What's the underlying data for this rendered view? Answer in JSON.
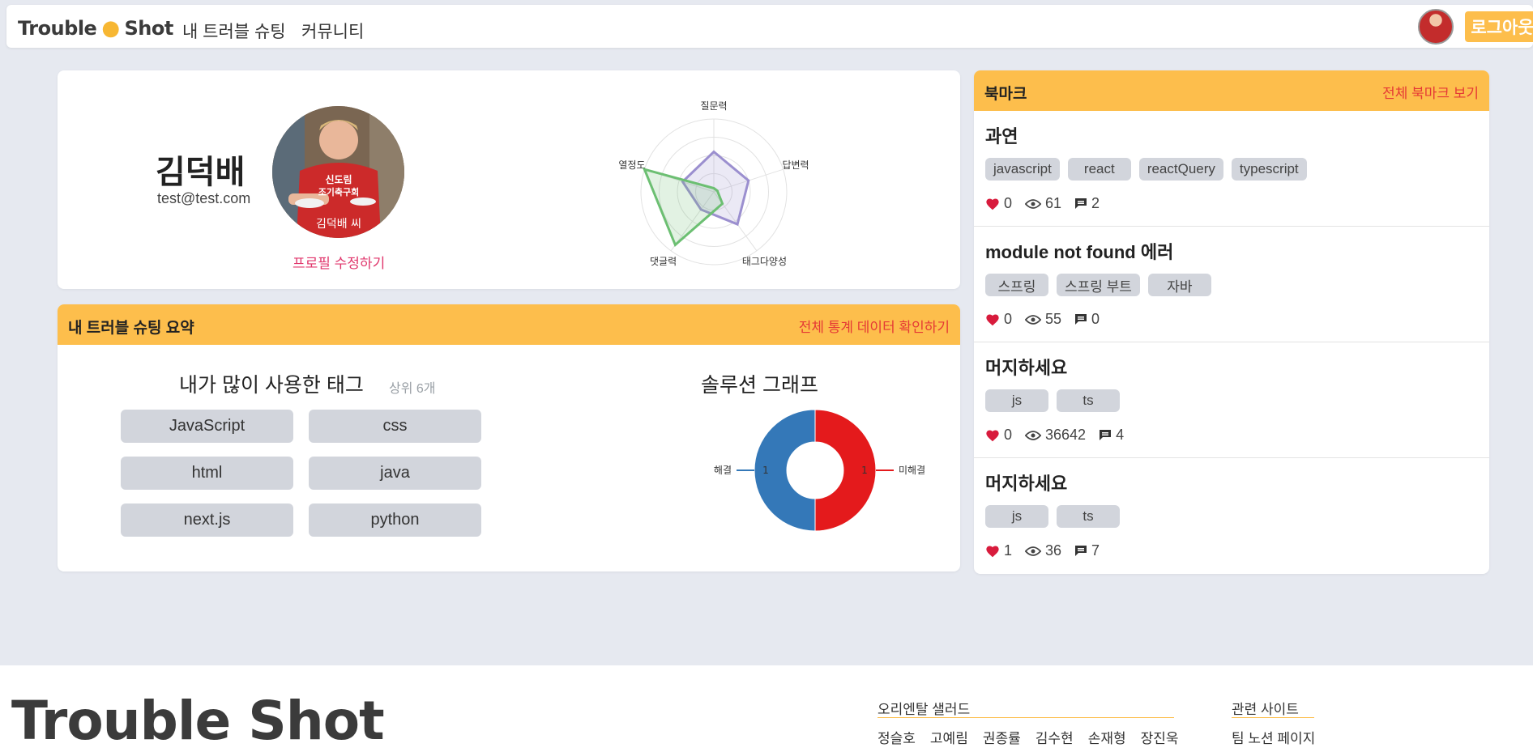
{
  "nav": {
    "logo_left": "Trouble",
    "logo_right": "Shot",
    "links": [
      "내 트러블 슈팅",
      "커뮤니티"
    ],
    "logout_label": "로그아웃"
  },
  "profile": {
    "name": "김덕배",
    "email": "test@test.com",
    "photo_caption": "김덕배 씨",
    "shirt_text_1": "신도림",
    "shirt_text_2": "조기축구회",
    "edit_label": "프로필 수정하기",
    "radar": {
      "axes": [
        "질문력",
        "답변력",
        "태그다양성",
        "댓글력",
        "열정도"
      ],
      "series": [
        {
          "color": "#9b8fcf",
          "values": [
            0.55,
            0.5,
            0.55,
            0.3,
            0.45
          ]
        },
        {
          "color": "#6cbf72",
          "values": [
            0.05,
            0.05,
            0.2,
            0.9,
            1.0
          ]
        }
      ]
    }
  },
  "summary": {
    "header_title": "내 트러블 슈팅 요약",
    "header_link": "전체 통계 데이터 확인하기",
    "tags_title": "내가 많이 사용한 태그",
    "tags_sub": "상위 6개",
    "tags": [
      "JavaScript",
      "css",
      "html",
      "java",
      "next.js",
      "python"
    ],
    "graph_title": "솔루션 그래프"
  },
  "chart_data": {
    "type": "pie",
    "categories": [
      "해결",
      "미해결"
    ],
    "values": [
      1,
      1
    ],
    "colors": [
      "#3478b8",
      "#e41a1c"
    ]
  },
  "bookmarks": {
    "header_title": "북마크",
    "header_link": "전체 북마크 보기",
    "items": [
      {
        "title": "과연",
        "tags": [
          "javascript",
          "react",
          "reactQuery",
          "typescript"
        ],
        "likes": "0",
        "views": "61",
        "comments": "2"
      },
      {
        "title": "module not found 에러",
        "tags": [
          "스프링",
          "스프링 부트",
          "자바"
        ],
        "likes": "0",
        "views": "55",
        "comments": "0"
      },
      {
        "title": "머지하세요",
        "tags": [
          "js",
          "ts"
        ],
        "likes": "0",
        "views": "36642",
        "comments": "4"
      },
      {
        "title": "머지하세요",
        "tags": [
          "js",
          "ts"
        ],
        "likes": "1",
        "views": "36",
        "comments": "7"
      }
    ]
  },
  "footer": {
    "logo": "Trouble Shot",
    "team_title": "오리엔탈 샐러드",
    "members": [
      "정슬호",
      "고예림",
      "권종률",
      "김수현",
      "손재형",
      "장진욱"
    ],
    "sites_title": "관련 사이트",
    "site_link": "팀 노션 페이지"
  },
  "colors": {
    "accent": "#fdbe4c",
    "link_red": "#e53935",
    "tag_bg": "#d2d5dc",
    "heart": "#d81b3c"
  }
}
